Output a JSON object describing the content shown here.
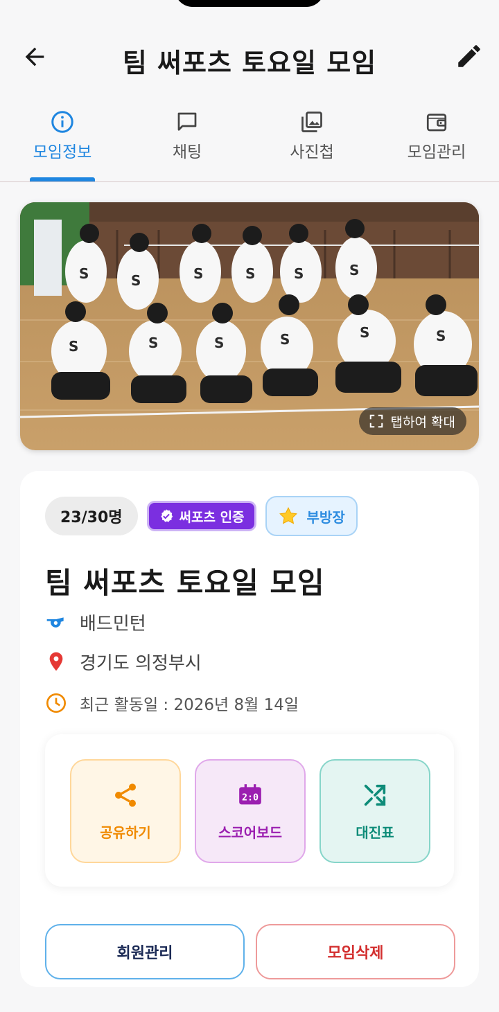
{
  "header": {
    "title": "팀 써포츠 토요일 모임"
  },
  "tabs": [
    {
      "label": "모임정보",
      "icon": "info-icon",
      "active": true
    },
    {
      "label": "채팅",
      "icon": "chat-icon",
      "active": false
    },
    {
      "label": "사진첩",
      "icon": "gallery-icon",
      "active": false
    },
    {
      "label": "모임관리",
      "icon": "wallet-icon",
      "active": false
    }
  ],
  "photo": {
    "zoom_label": "탭하여 확대"
  },
  "group": {
    "member_count": "23/30명",
    "cert_label": "써포츠 인증",
    "role_label": "부방장",
    "name": "팀 써포츠 토요일 모임",
    "sport": "배드민턴",
    "location": "경기도 의정부시",
    "last_activity": "최근 활동일 : 2026년 8월 14일"
  },
  "actions": [
    {
      "label": "공유하기",
      "icon": "share-icon"
    },
    {
      "label": "스코어보드",
      "icon": "scoreboard-icon"
    },
    {
      "label": "대진표",
      "icon": "shuffle-icon"
    }
  ],
  "buttons": {
    "members": "회원관리",
    "delete": "모임삭제"
  },
  "colors": {
    "accent": "#1f86e0",
    "cert": "#7b2fe0",
    "delete": "#d32f2f",
    "share": "#f08a00",
    "scoreboard": "#9b1fb0",
    "bracket": "#0e8c79"
  }
}
